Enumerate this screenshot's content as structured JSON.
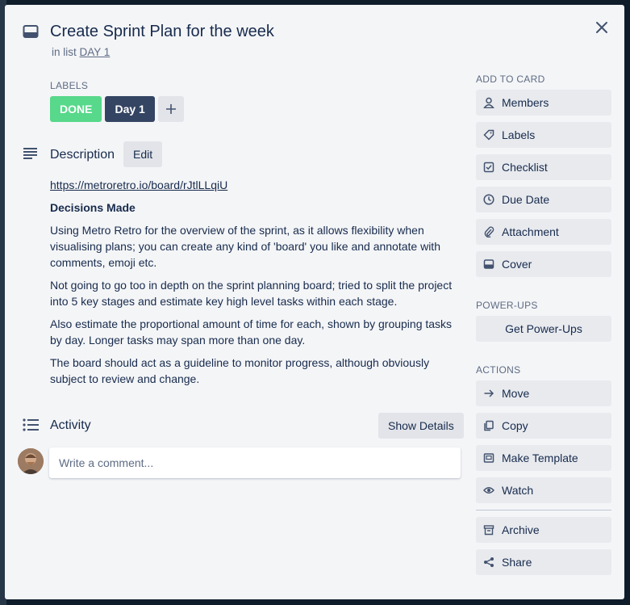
{
  "card": {
    "title": "Create Sprint Plan for the week",
    "in_list_prefix": "in list",
    "list_name": "DAY 1"
  },
  "labels": {
    "heading": "LABELS",
    "items": [
      {
        "text": "DONE",
        "color": "#61bd4f"
      },
      {
        "text": "Day 1",
        "color": "#344563"
      }
    ]
  },
  "description": {
    "heading": "Description",
    "edit_label": "Edit",
    "link": "https://metroretro.io/board/rJtlLLqiU",
    "bold_heading": "Decisions Made",
    "paragraphs": [
      "Using Metro Retro for the overview of the sprint, as it allows flexibility when visualising plans; you can create any kind of 'board' you like and annotate with comments, emoji etc.",
      "Not going to go too in depth on the sprint planning board; tried to split the project into 5 key stages and estimate key high level tasks within each stage.",
      "Also estimate the proportional amount of time for each, shown by grouping tasks by day. Longer tasks may span more than one day.",
      "The board should act as a guideline to monitor progress, although obviously subject to review and change."
    ]
  },
  "activity": {
    "heading": "Activity",
    "show_details_label": "Show Details",
    "comment_placeholder": "Write a comment..."
  },
  "sidebar": {
    "add_to_card_heading": "ADD TO CARD",
    "add_to_card": [
      {
        "label": "Members",
        "icon": "person-icon"
      },
      {
        "label": "Labels",
        "icon": "tag-icon"
      },
      {
        "label": "Checklist",
        "icon": "checkbox-icon"
      },
      {
        "label": "Due Date",
        "icon": "clock-icon"
      },
      {
        "label": "Attachment",
        "icon": "paperclip-icon"
      },
      {
        "label": "Cover",
        "icon": "cover-icon"
      }
    ],
    "powerups_heading": "POWER-UPS",
    "get_powerups_label": "Get Power-Ups",
    "actions_heading": "ACTIONS",
    "actions": [
      {
        "label": "Move",
        "icon": "arrow-right-icon"
      },
      {
        "label": "Copy",
        "icon": "copy-icon"
      },
      {
        "label": "Make Template",
        "icon": "template-icon"
      },
      {
        "label": "Watch",
        "icon": "eye-icon"
      }
    ],
    "actions_secondary": [
      {
        "label": "Archive",
        "icon": "archive-icon"
      },
      {
        "label": "Share",
        "icon": "share-icon"
      }
    ]
  }
}
